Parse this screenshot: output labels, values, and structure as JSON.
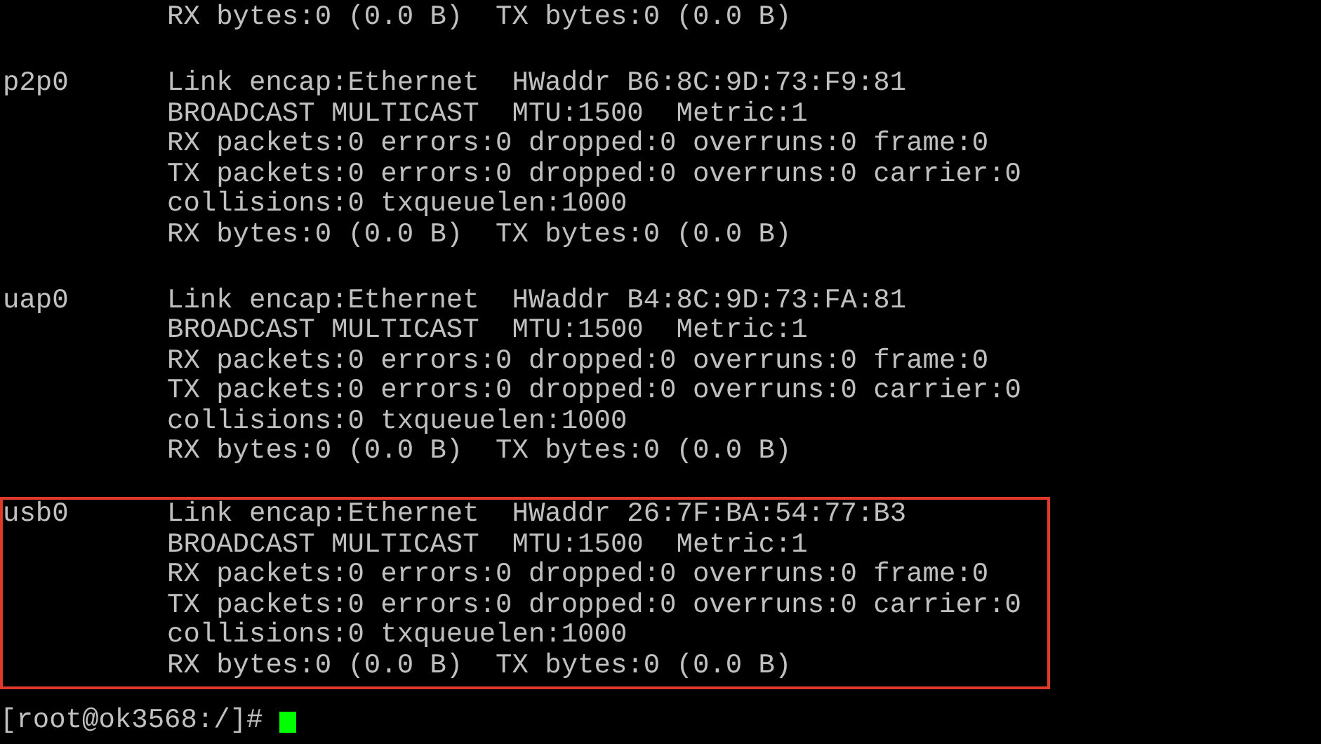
{
  "interfaces": [
    {
      "highlighted": false,
      "lines": [
        "RX bytes:0 (0.0 B)  TX bytes:0 (0.0 B)"
      ]
    },
    {
      "name": "p2p0",
      "highlighted": false,
      "lines": [
        "Link encap:Ethernet  HWaddr B6:8C:9D:73:F9:81",
        "BROADCAST MULTICAST  MTU:1500  Metric:1",
        "RX packets:0 errors:0 dropped:0 overruns:0 frame:0",
        "TX packets:0 errors:0 dropped:0 overruns:0 carrier:0",
        "collisions:0 txqueuelen:1000",
        "RX bytes:0 (0.0 B)  TX bytes:0 (0.0 B)"
      ]
    },
    {
      "name": "uap0",
      "highlighted": false,
      "lines": [
        "Link encap:Ethernet  HWaddr B4:8C:9D:73:FA:81",
        "BROADCAST MULTICAST  MTU:1500  Metric:1",
        "RX packets:0 errors:0 dropped:0 overruns:0 frame:0",
        "TX packets:0 errors:0 dropped:0 overruns:0 carrier:0",
        "collisions:0 txqueuelen:1000",
        "RX bytes:0 (0.0 B)  TX bytes:0 (0.0 B)"
      ]
    },
    {
      "name": "usb0",
      "highlighted": true,
      "lines": [
        "Link encap:Ethernet  HWaddr 26:7F:BA:54:77:B3",
        "BROADCAST MULTICAST  MTU:1500  Metric:1",
        "RX packets:0 errors:0 dropped:0 overruns:0 frame:0",
        "TX packets:0 errors:0 dropped:0 overruns:0 carrier:0",
        "collisions:0 txqueuelen:1000",
        "RX bytes:0 (0.0 B)  TX bytes:0 (0.0 B)"
      ]
    }
  ],
  "prompt": {
    "text": "[root@ok3568:/]#",
    "cursor": true
  }
}
